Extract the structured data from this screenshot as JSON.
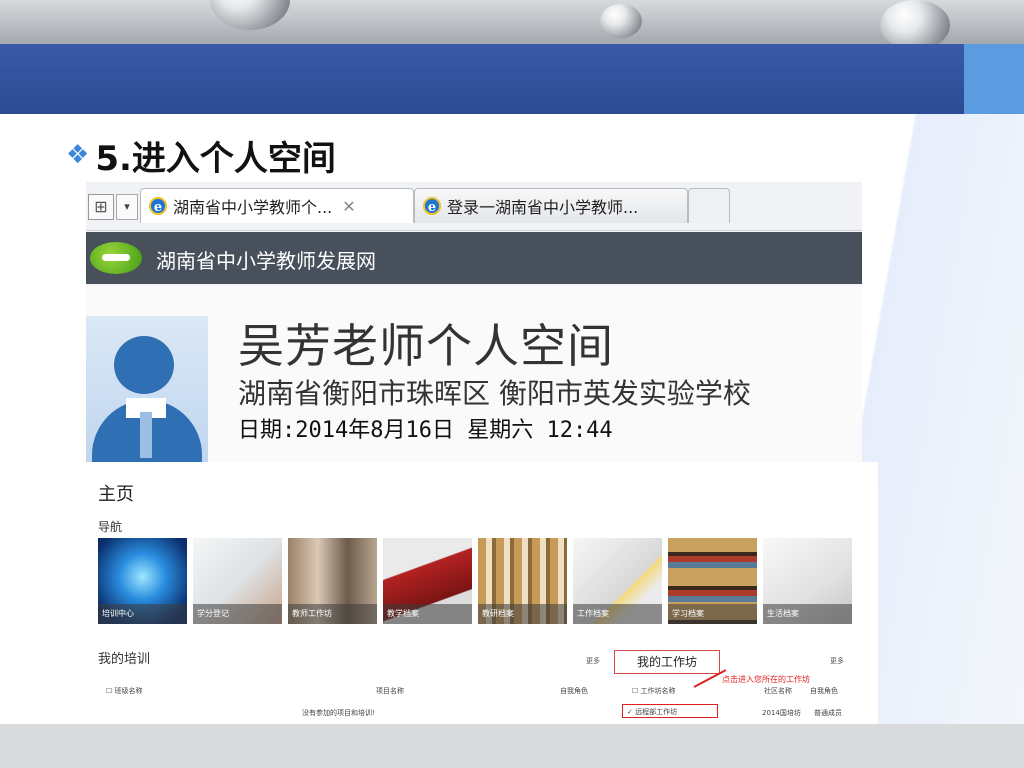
{
  "slide": {
    "title": "5.进入个人空间"
  },
  "browser": {
    "tabs": [
      {
        "label": "湖南省中小学教师个...",
        "active": true
      },
      {
        "label": "登录一湖南省中小学教师...",
        "active": false
      }
    ]
  },
  "site": {
    "name": "湖南省中小学教师发展网"
  },
  "profile": {
    "name": "吴芳老师个人空间",
    "org": "湖南省衡阳市珠晖区  衡阳市英发实验学校",
    "date": "日期:2014年8月16日 星期六 12:44"
  },
  "portal": {
    "home_title": "主页",
    "nav_label": "导航",
    "tiles": [
      "培训中心",
      "学分登记",
      "教师工作坊",
      "教学档案",
      "教研档案",
      "工作档案",
      "学习档案",
      "生活档案"
    ],
    "my_training": {
      "title": "我的培训",
      "more": "更多",
      "columns": [
        "班级名称",
        "项目名称",
        "自我角色"
      ],
      "empty": "没有参加的项目和培训!"
    },
    "my_workshop": {
      "tab": "我的工作坊",
      "more": "更多",
      "columns": [
        "工作坊名称",
        "社区名称",
        "自我角色"
      ],
      "callout": "点击进入您所在的工作坊",
      "row": {
        "name": "远程部工作坊",
        "community": "2014国培坊",
        "role": "普通成员"
      }
    }
  },
  "colors": {
    "band": "#2c4b93",
    "accent": "#3a86d8",
    "highlight": "#e02020"
  }
}
